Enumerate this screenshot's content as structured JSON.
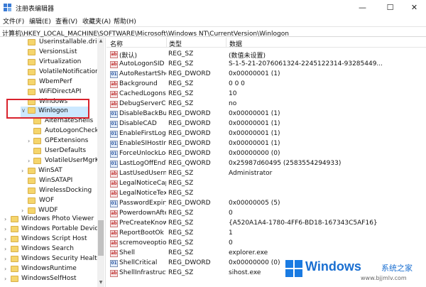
{
  "window": {
    "title": "注册表编辑器",
    "buttons": {
      "minimize": "—",
      "maximize": "☐",
      "close": "✕"
    }
  },
  "menu": [
    "文件(F)",
    "编辑(E)",
    "查看(V)",
    "收藏夹(A)",
    "帮助(H)"
  ],
  "address": "计算机\\HKEY_LOCAL_MACHINE\\SOFTWARE\\Microsoft\\Windows NT\\CurrentVersion\\Winlogon",
  "tree": {
    "items": [
      "Userinstallable.drivers",
      "VersionsList",
      "Virtualization",
      "VolatileNotifications",
      "WbemPerf",
      "WiFiDirectAPI",
      "Windows",
      "Winlogon",
      "AlternateShells",
      "AutoLogonChecked",
      "GPExtensions",
      "UserDefaults",
      "VolatileUserMgrKey",
      "WinSAT",
      "WinSATAPI",
      "WirelessDocking",
      "WOF",
      "WUDF",
      "Windows Photo Viewer",
      "Windows Portable Devices",
      "Windows Script Host",
      "Windows Search",
      "Windows Security Health",
      "WindowsRuntime",
      "WindowsSelfHost"
    ],
    "selected": "Winlogon"
  },
  "columns": {
    "name": "名称",
    "type": "类型",
    "data": "数据"
  },
  "values": [
    {
      "name": "(默认)",
      "type": "REG_SZ",
      "data": "(数值未设置)",
      "icon": "sz"
    },
    {
      "name": "AutoLogonSID",
      "type": "REG_SZ",
      "data": "S-1-5-21-2076061324-2245122314-93285449...",
      "icon": "sz"
    },
    {
      "name": "AutoRestartShell",
      "type": "REG_DWORD",
      "data": "0x00000001 (1)",
      "icon": "bin"
    },
    {
      "name": "Background",
      "type": "REG_SZ",
      "data": "0 0 0",
      "icon": "sz"
    },
    {
      "name": "CachedLogonsCount",
      "type": "REG_SZ",
      "data": "10",
      "icon": "sz"
    },
    {
      "name": "DebugServerCommand",
      "type": "REG_SZ",
      "data": "no",
      "icon": "sz"
    },
    {
      "name": "DisableBackButton",
      "type": "REG_DWORD",
      "data": "0x00000001 (1)",
      "icon": "bin"
    },
    {
      "name": "DisableCAD",
      "type": "REG_DWORD",
      "data": "0x00000001 (1)",
      "icon": "bin"
    },
    {
      "name": "EnableFirstLogonAnimation",
      "type": "REG_DWORD",
      "data": "0x00000001 (1)",
      "icon": "bin"
    },
    {
      "name": "EnableSIHostIntegration",
      "type": "REG_DWORD",
      "data": "0x00000001 (1)",
      "icon": "bin"
    },
    {
      "name": "ForceUnlockLogon",
      "type": "REG_DWORD",
      "data": "0x00000000 (0)",
      "icon": "bin"
    },
    {
      "name": "LastLogOffEndTimePerfCounter",
      "type": "REG_QWORD",
      "data": "0x25987d60495 (2583554294933)",
      "icon": "bin"
    },
    {
      "name": "LastUsedUsername",
      "type": "REG_SZ",
      "data": "Administrator",
      "icon": "sz"
    },
    {
      "name": "LegalNoticeCaption",
      "type": "REG_SZ",
      "data": "",
      "icon": "sz"
    },
    {
      "name": "LegalNoticeText",
      "type": "REG_SZ",
      "data": "",
      "icon": "sz"
    },
    {
      "name": "PasswordExpiryWarning",
      "type": "REG_DWORD",
      "data": "0x00000005 (5)",
      "icon": "bin"
    },
    {
      "name": "PowerdownAfterShutdown",
      "type": "REG_SZ",
      "data": "0",
      "icon": "sz"
    },
    {
      "name": "PreCreateKnownFolders",
      "type": "REG_SZ",
      "data": "{A520A1A4-1780-4FF6-BD18-167343C5AF16}",
      "icon": "sz"
    },
    {
      "name": "ReportBootOk",
      "type": "REG_SZ",
      "data": "1",
      "icon": "sz"
    },
    {
      "name": "scremoveoption",
      "type": "REG_SZ",
      "data": "0",
      "icon": "sz"
    },
    {
      "name": "Shell",
      "type": "REG_SZ",
      "data": "explorer.exe",
      "icon": "sz"
    },
    {
      "name": "ShellCritical",
      "type": "REG_DWORD",
      "data": "0x00000000 (0)",
      "icon": "bin"
    },
    {
      "name": "ShellInfrastructure",
      "type": "REG_SZ",
      "data": "sihost.exe",
      "icon": "sz"
    }
  ],
  "watermark": {
    "title": "Windows",
    "subtitle": "系统之家",
    "url": "www.bjjmlv.com"
  },
  "colors": {
    "selection": "#cce8ff",
    "highlight_box": "#d9232d",
    "folder": "#f5d56c",
    "watermark": "#1a6fd1"
  }
}
